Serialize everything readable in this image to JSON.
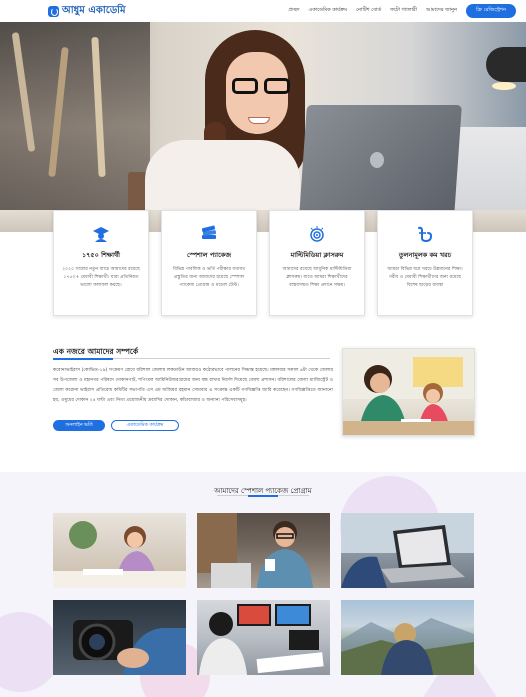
{
  "nav": {
    "logo_text": "আধুম একাডেমি",
    "menu": [
      "প্রচ্ছদ",
      "একাডেমিক কার্যক্রম",
      "নোটিশ বোর্ড",
      "ফটো গ্যালারী",
      "আমাদের জানুন"
    ],
    "register_label": "ফ্রি রেজিস্ট্রেশন"
  },
  "features": [
    {
      "icon": "graduate-icon",
      "title": "১৭৫০ শিক্ষার্থী",
      "text": "২০২০ সালের নতুন ব্যাচে আমাদের রয়েছে ১৭৫০+ মেধাবী শিক্ষার্থী। যারা প্রতিনিয়ত ভালো ফলাফল করছে।"
    },
    {
      "icon": "books-icon",
      "title": "স্পেশাল প্যাকেজ",
      "text": "বিভিন্ন পাবলিক ও ভর্তি পরীক্ষার যথাযথ প্রস্তুতির জন্য আমাদের রয়েছে স্পেশাল প্যাকেজ প্রোগ্রাম ও মডেল টেস্ট।"
    },
    {
      "icon": "multimedia-icon",
      "title": "মাল্টিমিডিয়া ক্লাসরুম",
      "text": "আমাদের রয়েছে আধুনিক মাল্টিমিডিয়া ক্লাসরুম। যাতে আমরা শিক্ষার্থীদের বাস্তবসম্মত শিক্ষা প্রদানে সক্ষম।"
    },
    {
      "icon": "taka-icon",
      "title": "তুলনামূলক কম খরচ",
      "text": "আমরা বিভিন্ন অপ্ল খরচে উন্নমানের শিক্ষা। গরীব ও মেধাবী শিক্ষার্থীদের জন্য রয়েছে বিশেষ ছাড়ের ব্যবস্থা"
    }
  ],
  "about": {
    "title": "এক নজরে আমাদের সম্পর্কে",
    "text": "করোনাভাইরাস (কোভিড-১৯) সংক্রমণ রোধে বরিশাল জেলায় লকডাউন আবারও কঠোরভাবে পালনের সিদ্ধান্ত হয়েছে। মঙ্গলবার সকাল ৬টা থেকে জেলার সব উপজেলা ও মহানগর পরিষদে দোকানপাট, শপিংমল আমিনিউজরগ্রামের জন্য বন্ধ রাখার নির্দেশ দিয়েছে জেলা প্রশাসন। বরিশালের জেলা ম্যাজিস্ট্রেট ও জেলা করোনা ভাইরাস প্রতিরোধ কমিটির সভাপতি এস এম অজিয়র রহমান সোমবার এ সংক্রান্ত একটি গণবিজ্ঞপ্তি জারি করেছেন। গণবিজ্ঞপ্তিতে জানানো হয়, ওষুধের দোকান ২৪ ঘণ্টা এবং নিত্য প্রয়োজনীয় দ্রব্যাদির দোকান, কাঁচাবাজার ও অন্যান্য পরিসেবাসমূহ।",
    "primary_button": "অনলাইন ভর্তি",
    "secondary_button": "একাডেমিক কার্যক্রম"
  },
  "programs": {
    "title": "আমাদের স্পেশাল প্যাকেজ প্রোগ্রাম"
  }
}
